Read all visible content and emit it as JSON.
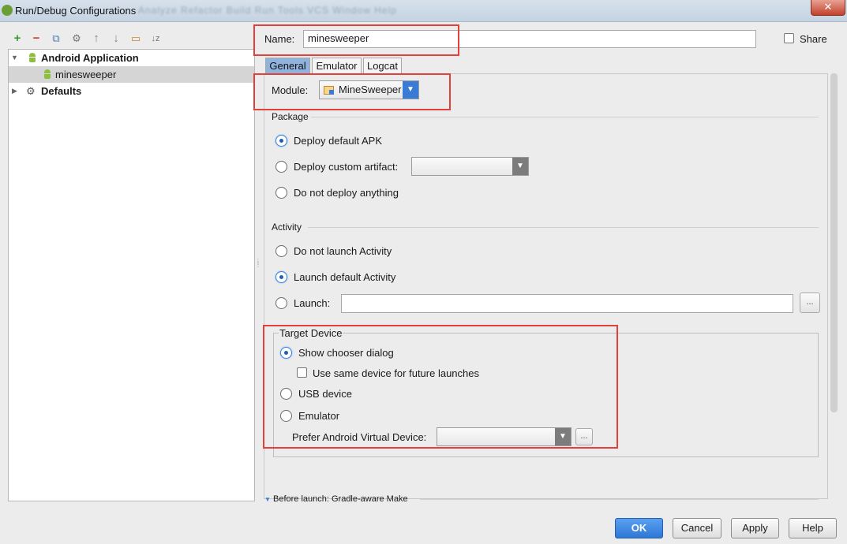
{
  "window": {
    "title": "Run/Debug Configurations",
    "background_menu_ghost": "Analyze  Refactor  Build  Run  Tools  VCS  Window  Help",
    "close_label": "✕"
  },
  "toolbar": {
    "add": "+",
    "remove": "−",
    "copy": "⧉",
    "edit_defaults": "⚙",
    "move_up": "↑",
    "move_down": "↓",
    "folder": "▭",
    "sort": "↓z"
  },
  "tree": {
    "root_label": "Android Application",
    "child_label": "minesweeper",
    "defaults_label": "Defaults"
  },
  "name": {
    "label": "Name:",
    "value": "minesweeper"
  },
  "share_label": "Share",
  "tabs": [
    "General",
    "Emulator",
    "Logcat"
  ],
  "module": {
    "label": "Module:",
    "value": "MineSweeper"
  },
  "package": {
    "title": "Package",
    "opt1": "Deploy default APK",
    "opt2": "Deploy custom artifact:",
    "opt3": "Do not deploy anything"
  },
  "activity": {
    "title": "Activity",
    "opt1": "Do not launch Activity",
    "opt2": "Launch default Activity",
    "opt3": "Launch:",
    "launch_value": ""
  },
  "target": {
    "title": "Target Device",
    "opt1": "Show chooser dialog",
    "same_device": "Use same device for future launches",
    "opt2": "USB device",
    "opt3": "Emulator",
    "prefer_avd": "Prefer Android Virtual Device:",
    "avd_value": ""
  },
  "before_launch": "Before launch: Gradle-aware Make",
  "buttons": {
    "ok": "OK",
    "cancel": "Cancel",
    "apply": "Apply",
    "help": "Help"
  },
  "ellipsis": "...",
  "dropdown_arrow": "▼",
  "tree_expanded_arrow": "▼",
  "tree_collapsed_arrow": "▶",
  "colors": {
    "highlight_box": "#e2403a",
    "accent": "#3a7bd5"
  }
}
